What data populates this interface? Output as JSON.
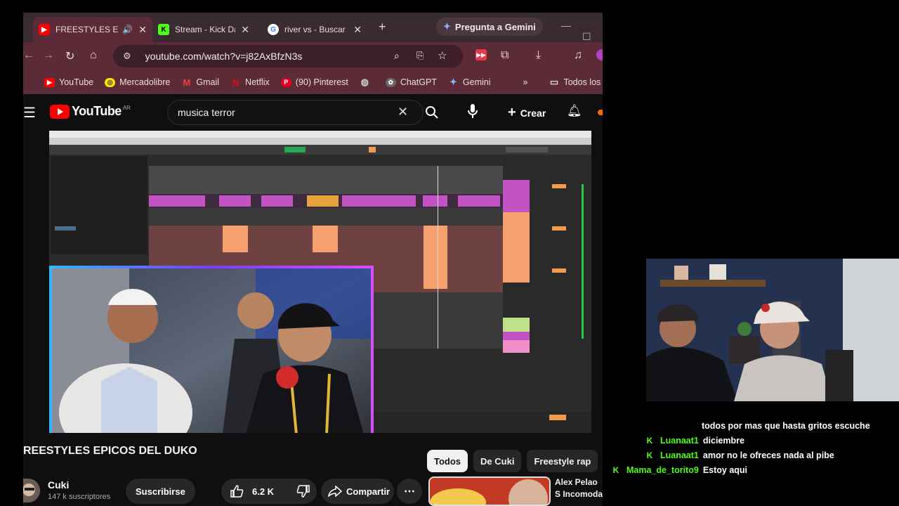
{
  "browser": {
    "tabs": [
      {
        "title": "FREESTYLES EI",
        "icon": "youtube-icon",
        "active": true
      },
      {
        "title": "Stream - Kick Das",
        "icon": "kick-icon",
        "active": false
      },
      {
        "title": "river vs - Buscar c",
        "icon": "google-icon",
        "active": false
      }
    ],
    "gemini_label": "Pregunta a Gemini",
    "url": "youtube.com/watch?v=j82AxBfzN3s",
    "bookmarks": [
      {
        "label": "YouTube",
        "icon": "youtube-icon",
        "color": "#ff0000"
      },
      {
        "label": "Mercadolibre",
        "icon": "mercadolibre-icon",
        "color": "#ffe600"
      },
      {
        "label": "Gmail",
        "icon": "gmail-icon",
        "color": "#ea4335"
      },
      {
        "label": "Netflix",
        "icon": "netflix-icon",
        "color": "#e50914"
      },
      {
        "label": "(90) Pinterest",
        "icon": "pinterest-icon",
        "color": "#e60023"
      },
      {
        "label": "",
        "icon": "globe-icon",
        "color": "#9aa0a6"
      },
      {
        "label": "ChatGPT",
        "icon": "chatgpt-icon",
        "color": "#444444"
      },
      {
        "label": "Gemini",
        "icon": "gemini-icon",
        "color": "#4285f4"
      }
    ],
    "all_bookmarks_label": "Todos los ma"
  },
  "youtube": {
    "logo_text": "YouTube",
    "country_code": "AR",
    "search_value": "musica terror",
    "create_label": "Crear",
    "video_title": "REESTYLES EPICOS DEL DUKO",
    "channel_name": "Cuki",
    "subscribers": "147 k suscriptores",
    "subscribe_label": "Suscribirse",
    "likes": "6.2 K",
    "share_label": "Compartir",
    "chips": [
      "Todos",
      "De Cuki",
      "Freestyle rap"
    ],
    "recommended_title": "Alex Pelao S Incomoda ..."
  },
  "chat": [
    {
      "user": "",
      "message": "todos por mas que hasta gritos escuche",
      "kick_badge": false
    },
    {
      "user": "Luanaat1",
      "message": "diciembre",
      "kick_badge": true
    },
    {
      "user": "Luanaat1",
      "message": "amor no le ofreces nada al pibe",
      "kick_badge": true
    },
    {
      "user": "Mama_de_torito9",
      "message": "Estoy aqui",
      "kick_badge": true
    }
  ],
  "colors": {
    "kick_green": "#53fc18",
    "youtube_red": "#ff0000",
    "browser_frame": "#5b2b38"
  }
}
